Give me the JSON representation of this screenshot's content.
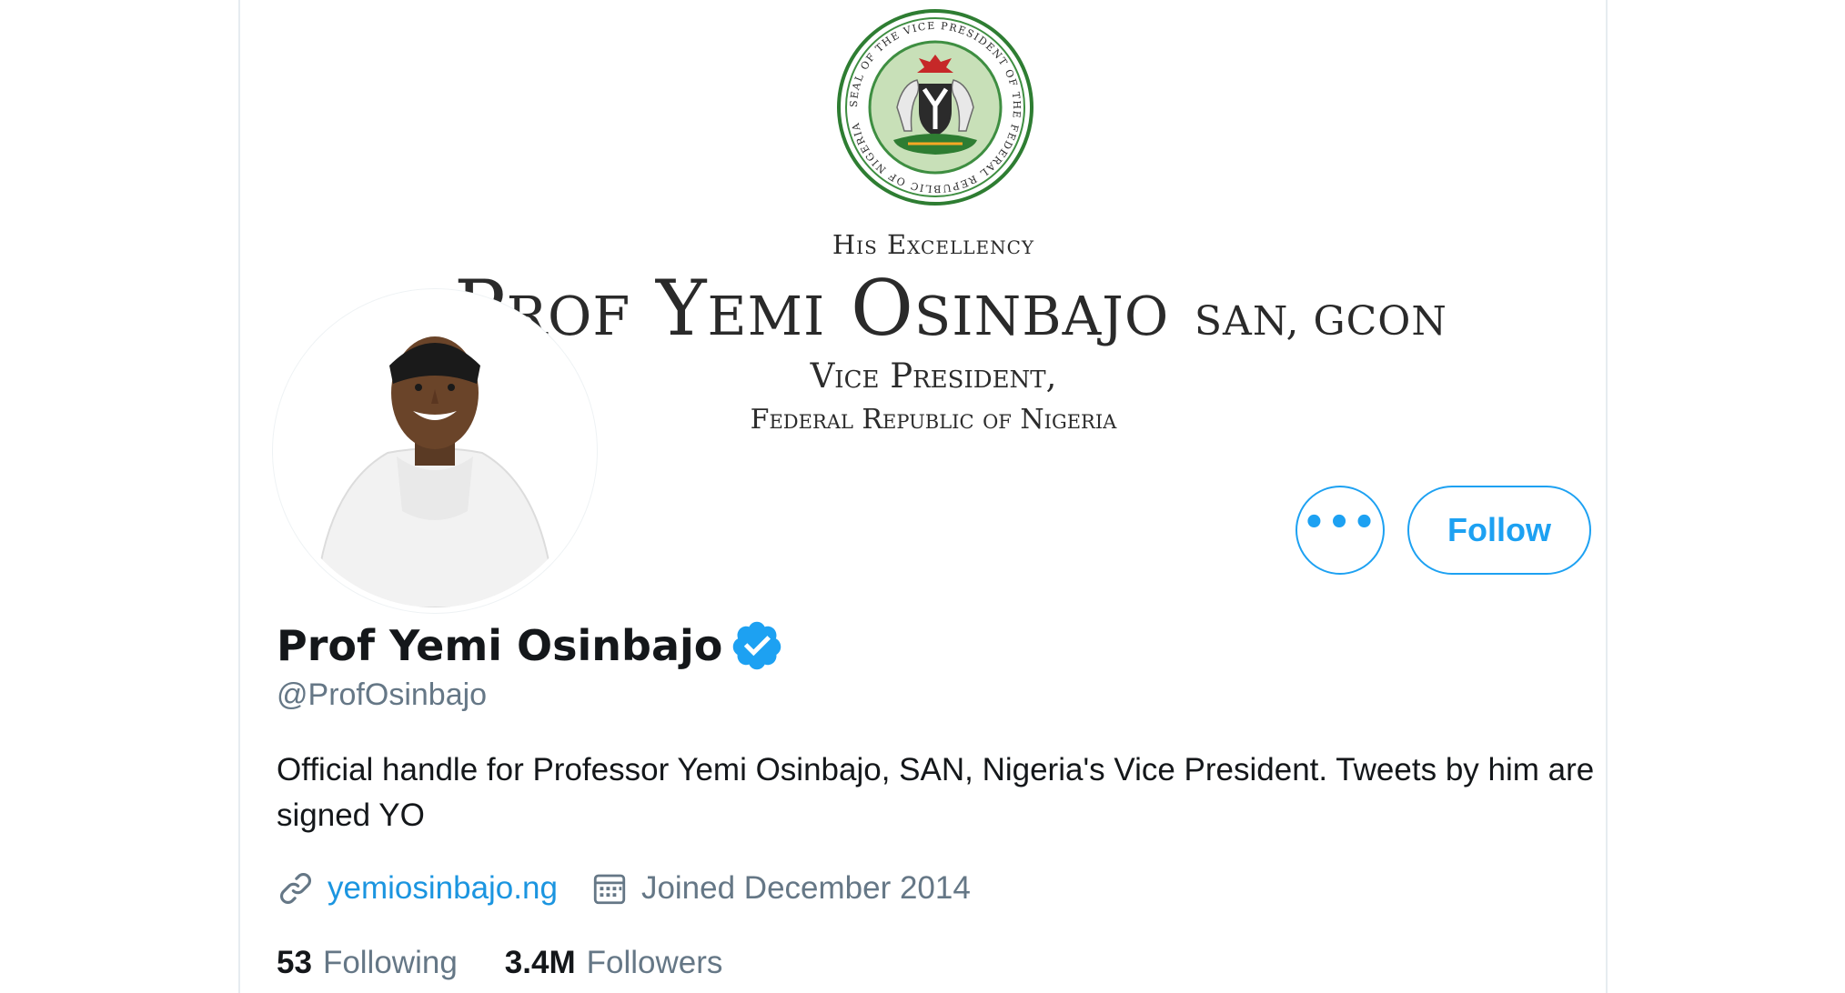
{
  "banner": {
    "title_line": "His Excellency",
    "name_line": "Prof Yemi Osinbajo",
    "name_suffix": "SAN, GCON",
    "role_line": "Vice President,",
    "country_line": "Federal Republic of Nigeria",
    "seal_text": "SEAL OF THE VICE PRESIDENT OF THE FEDERAL REPUBLIC OF NIGERIA"
  },
  "profile": {
    "display_name": "Prof Yemi Osinbajo",
    "handle": "@ProfOsinbajo",
    "bio": "Official handle for Professor Yemi Osinbajo, SAN, Nigeria's Vice President. Tweets by him are signed YO",
    "website": "yemiosinbajo.ng",
    "joined": "Joined December 2014",
    "verified": true
  },
  "actions": {
    "more_label": "•••",
    "follow_label": "Follow"
  },
  "stats": {
    "following_count": "53",
    "following_label": "Following",
    "followers_count": "3.4M",
    "followers_label": "Followers"
  },
  "icons": {
    "more": "more-icon",
    "verified": "verified-badge-icon",
    "link": "link-icon",
    "calendar": "calendar-icon"
  },
  "colors": {
    "accent": "#1da1f2",
    "link": "#1b95e0",
    "secondary_text": "#657786",
    "primary_text": "#14171a",
    "border": "#e6ecf0"
  }
}
